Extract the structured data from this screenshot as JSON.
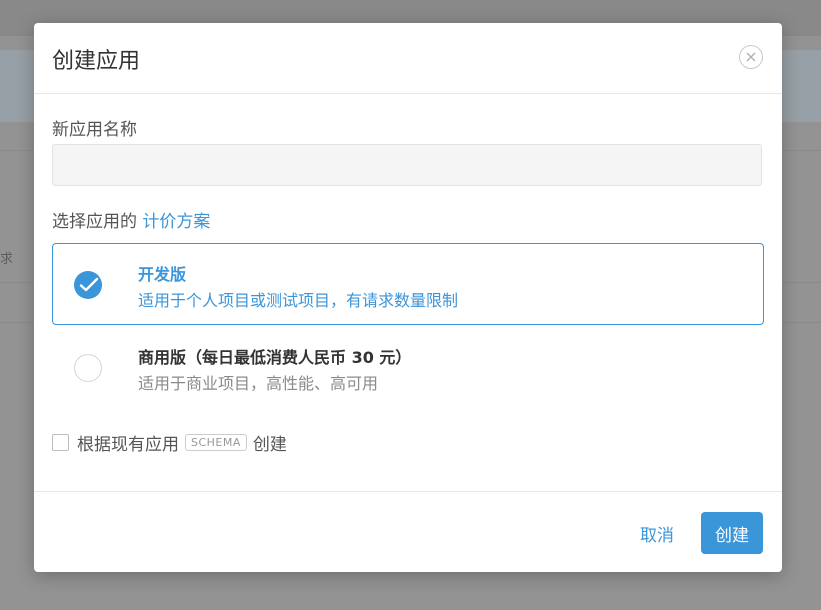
{
  "background": {
    "partial_text": "求"
  },
  "modal": {
    "title": "创建应用",
    "close_icon": "close-circle-icon"
  },
  "form": {
    "name_label": "新应用名称",
    "name_value": "",
    "name_placeholder": "",
    "plan_label": "选择应用的",
    "plan_link": "计价方案"
  },
  "plans": [
    {
      "name": "开发版",
      "description": "适用于个人项目或测试项目，有请求数量限制",
      "selected": true
    },
    {
      "name": "商用版（每日最低消费人民币 30 元）",
      "description": "适用于商业项目，高性能、高可用",
      "selected": false
    }
  ],
  "schema_option": {
    "checked": false,
    "prefix": "根据现有应用",
    "tag": "SCHEMA",
    "suffix": "创建"
  },
  "footer": {
    "cancel_label": "取消",
    "create_label": "创建"
  },
  "colors": {
    "accent": "#3b95d9",
    "overlay": "#8f8f8f"
  }
}
